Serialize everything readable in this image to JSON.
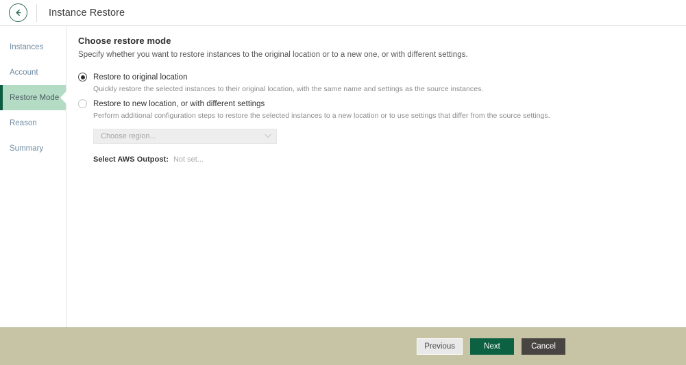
{
  "titlebar": {
    "back_icon": "back-arrow-icon",
    "title": "Instance Restore"
  },
  "sidebar": {
    "items": [
      {
        "label": "Instances",
        "active": false
      },
      {
        "label": "Account",
        "active": false
      },
      {
        "label": "Restore Mode",
        "active": true
      },
      {
        "label": "Reason",
        "active": false
      },
      {
        "label": "Summary",
        "active": false
      }
    ],
    "active_accent_color": "#0c5c42",
    "active_background_color": "#b4dcc5",
    "link_color": "#6f8ba3"
  },
  "main": {
    "title": "Choose restore mode",
    "subtitle": "Specify whether you want to restore instances to the original location or to a new one, or with different settings.",
    "options": [
      {
        "label": "Restore to original location",
        "description": "Quickly restore the selected instances to their original location, with the same name and settings as the source instances.",
        "selected": true
      },
      {
        "label": "Restore to new location, or with different settings",
        "description": "Perform additional configuration steps to restore the selected instances to a new location or to use settings that differ from the source settings.",
        "selected": false
      }
    ],
    "region_select": {
      "placeholder": "Choose region...",
      "value": "Choose region...",
      "chevron_icon": "chevron-down-icon",
      "disabled": true
    },
    "outpost": {
      "label": "Select AWS Outpost:",
      "value": "Not set..."
    }
  },
  "footer": {
    "previous_label": "Previous",
    "next_label": "Next",
    "cancel_label": "Cancel",
    "background_color": "#c6c4a5",
    "next_color": "#0c6143",
    "cancel_color": "#474441"
  }
}
